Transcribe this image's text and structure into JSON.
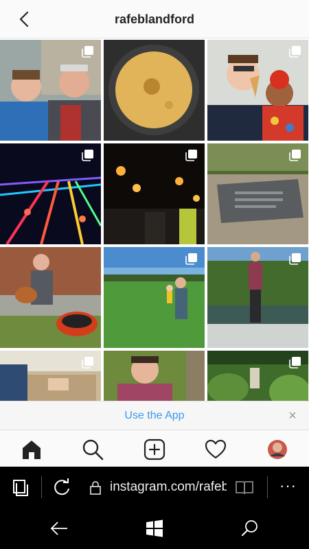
{
  "header": {
    "title": "rafeblandford",
    "back_icon": "chevron-left-icon"
  },
  "grid": {
    "tiles": [
      {
        "label": "two-men-portrait",
        "multi": true
      },
      {
        "label": "pancake-in-pan",
        "multi": false
      },
      {
        "label": "man-with-ice-cream-and-child",
        "multi": true
      },
      {
        "label": "colored-light-installation",
        "multi": true
      },
      {
        "label": "night-torch-procession",
        "multi": true
      },
      {
        "label": "memorial-plaque",
        "multi": true
      },
      {
        "label": "man-with-chicken-and-mower",
        "multi": false
      },
      {
        "label": "field-with-people",
        "multi": true
      },
      {
        "label": "man-on-punt-boat",
        "multi": true
      },
      {
        "label": "woodwork-bench",
        "multi": true
      },
      {
        "label": "selfie-in-garden",
        "multi": false
      },
      {
        "label": "garden-pond",
        "multi": true
      }
    ]
  },
  "use_app_banner": {
    "label": "Use the App",
    "close": "×"
  },
  "tabbar": {
    "items": [
      "home-icon",
      "search-icon",
      "add-post-icon",
      "heart-icon",
      "profile-avatar"
    ]
  },
  "browser": {
    "url": "instagram.com/rafeb",
    "more": "···"
  },
  "colors": {
    "accent": "#3897f0",
    "header_bg": "#fafafa",
    "browser_bg": "#000000"
  }
}
